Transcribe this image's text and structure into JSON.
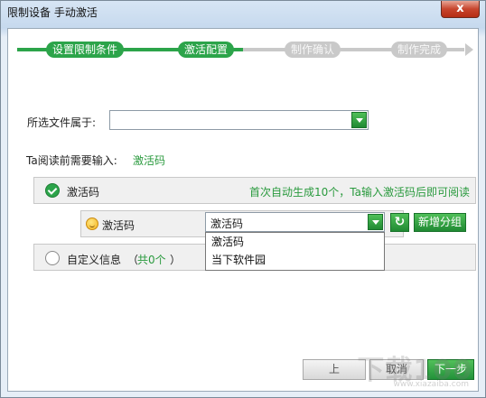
{
  "window": {
    "title": "限制设备 手动激活",
    "close_label": "x"
  },
  "steps": [
    {
      "label": "设置限制条件",
      "state": "done"
    },
    {
      "label": "激活配置",
      "state": "current"
    },
    {
      "label": "制作确认",
      "state": "pending"
    },
    {
      "label": "制作完成",
      "state": "pending"
    }
  ],
  "form": {
    "file_belongs_label": "所选文件属于:",
    "file_belongs_value": "",
    "input_before_read_label": "Ta阅读前需要输入:",
    "input_before_read_value": "激活码"
  },
  "activation_panel": {
    "title": "激活码",
    "hint": "首次自动生成10个，Ta输入激活码后即可阅读",
    "row_label": "激活码",
    "select_value": "激活码",
    "refresh_icon": "↻",
    "add_group_label": "新增分组"
  },
  "dropdown": {
    "options": [
      "激活码",
      "当下软件园"
    ]
  },
  "custom_panel": {
    "label": "自定义信息",
    "count_prefix": "（",
    "count_text": "共0个",
    "count_suffix": "）"
  },
  "footer": {
    "prev_label": "上",
    "middle_label": "取消",
    "next_label": "下一步"
  },
  "watermark": {
    "main": "下载100",
    "sub": "www.xiazaiba.com"
  },
  "colors": {
    "accent_green": "#2ca44a",
    "pending_gray": "#c9c9c9"
  }
}
